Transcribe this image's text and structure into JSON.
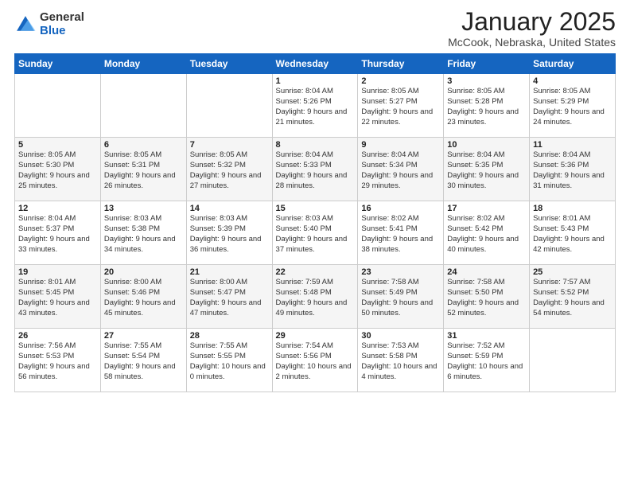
{
  "logo": {
    "general": "General",
    "blue": "Blue"
  },
  "header": {
    "title": "January 2025",
    "subtitle": "McCook, Nebraska, United States"
  },
  "weekdays": [
    "Sunday",
    "Monday",
    "Tuesday",
    "Wednesday",
    "Thursday",
    "Friday",
    "Saturday"
  ],
  "weeks": [
    [
      {
        "day": "",
        "sunrise": "",
        "sunset": "",
        "daylight": ""
      },
      {
        "day": "",
        "sunrise": "",
        "sunset": "",
        "daylight": ""
      },
      {
        "day": "",
        "sunrise": "",
        "sunset": "",
        "daylight": ""
      },
      {
        "day": "1",
        "sunrise": "Sunrise: 8:04 AM",
        "sunset": "Sunset: 5:26 PM",
        "daylight": "Daylight: 9 hours and 21 minutes."
      },
      {
        "day": "2",
        "sunrise": "Sunrise: 8:05 AM",
        "sunset": "Sunset: 5:27 PM",
        "daylight": "Daylight: 9 hours and 22 minutes."
      },
      {
        "day": "3",
        "sunrise": "Sunrise: 8:05 AM",
        "sunset": "Sunset: 5:28 PM",
        "daylight": "Daylight: 9 hours and 23 minutes."
      },
      {
        "day": "4",
        "sunrise": "Sunrise: 8:05 AM",
        "sunset": "Sunset: 5:29 PM",
        "daylight": "Daylight: 9 hours and 24 minutes."
      }
    ],
    [
      {
        "day": "5",
        "sunrise": "Sunrise: 8:05 AM",
        "sunset": "Sunset: 5:30 PM",
        "daylight": "Daylight: 9 hours and 25 minutes."
      },
      {
        "day": "6",
        "sunrise": "Sunrise: 8:05 AM",
        "sunset": "Sunset: 5:31 PM",
        "daylight": "Daylight: 9 hours and 26 minutes."
      },
      {
        "day": "7",
        "sunrise": "Sunrise: 8:05 AM",
        "sunset": "Sunset: 5:32 PM",
        "daylight": "Daylight: 9 hours and 27 minutes."
      },
      {
        "day": "8",
        "sunrise": "Sunrise: 8:04 AM",
        "sunset": "Sunset: 5:33 PM",
        "daylight": "Daylight: 9 hours and 28 minutes."
      },
      {
        "day": "9",
        "sunrise": "Sunrise: 8:04 AM",
        "sunset": "Sunset: 5:34 PM",
        "daylight": "Daylight: 9 hours and 29 minutes."
      },
      {
        "day": "10",
        "sunrise": "Sunrise: 8:04 AM",
        "sunset": "Sunset: 5:35 PM",
        "daylight": "Daylight: 9 hours and 30 minutes."
      },
      {
        "day": "11",
        "sunrise": "Sunrise: 8:04 AM",
        "sunset": "Sunset: 5:36 PM",
        "daylight": "Daylight: 9 hours and 31 minutes."
      }
    ],
    [
      {
        "day": "12",
        "sunrise": "Sunrise: 8:04 AM",
        "sunset": "Sunset: 5:37 PM",
        "daylight": "Daylight: 9 hours and 33 minutes."
      },
      {
        "day": "13",
        "sunrise": "Sunrise: 8:03 AM",
        "sunset": "Sunset: 5:38 PM",
        "daylight": "Daylight: 9 hours and 34 minutes."
      },
      {
        "day": "14",
        "sunrise": "Sunrise: 8:03 AM",
        "sunset": "Sunset: 5:39 PM",
        "daylight": "Daylight: 9 hours and 36 minutes."
      },
      {
        "day": "15",
        "sunrise": "Sunrise: 8:03 AM",
        "sunset": "Sunset: 5:40 PM",
        "daylight": "Daylight: 9 hours and 37 minutes."
      },
      {
        "day": "16",
        "sunrise": "Sunrise: 8:02 AM",
        "sunset": "Sunset: 5:41 PM",
        "daylight": "Daylight: 9 hours and 38 minutes."
      },
      {
        "day": "17",
        "sunrise": "Sunrise: 8:02 AM",
        "sunset": "Sunset: 5:42 PM",
        "daylight": "Daylight: 9 hours and 40 minutes."
      },
      {
        "day": "18",
        "sunrise": "Sunrise: 8:01 AM",
        "sunset": "Sunset: 5:43 PM",
        "daylight": "Daylight: 9 hours and 42 minutes."
      }
    ],
    [
      {
        "day": "19",
        "sunrise": "Sunrise: 8:01 AM",
        "sunset": "Sunset: 5:45 PM",
        "daylight": "Daylight: 9 hours and 43 minutes."
      },
      {
        "day": "20",
        "sunrise": "Sunrise: 8:00 AM",
        "sunset": "Sunset: 5:46 PM",
        "daylight": "Daylight: 9 hours and 45 minutes."
      },
      {
        "day": "21",
        "sunrise": "Sunrise: 8:00 AM",
        "sunset": "Sunset: 5:47 PM",
        "daylight": "Daylight: 9 hours and 47 minutes."
      },
      {
        "day": "22",
        "sunrise": "Sunrise: 7:59 AM",
        "sunset": "Sunset: 5:48 PM",
        "daylight": "Daylight: 9 hours and 49 minutes."
      },
      {
        "day": "23",
        "sunrise": "Sunrise: 7:58 AM",
        "sunset": "Sunset: 5:49 PM",
        "daylight": "Daylight: 9 hours and 50 minutes."
      },
      {
        "day": "24",
        "sunrise": "Sunrise: 7:58 AM",
        "sunset": "Sunset: 5:50 PM",
        "daylight": "Daylight: 9 hours and 52 minutes."
      },
      {
        "day": "25",
        "sunrise": "Sunrise: 7:57 AM",
        "sunset": "Sunset: 5:52 PM",
        "daylight": "Daylight: 9 hours and 54 minutes."
      }
    ],
    [
      {
        "day": "26",
        "sunrise": "Sunrise: 7:56 AM",
        "sunset": "Sunset: 5:53 PM",
        "daylight": "Daylight: 9 hours and 56 minutes."
      },
      {
        "day": "27",
        "sunrise": "Sunrise: 7:55 AM",
        "sunset": "Sunset: 5:54 PM",
        "daylight": "Daylight: 9 hours and 58 minutes."
      },
      {
        "day": "28",
        "sunrise": "Sunrise: 7:55 AM",
        "sunset": "Sunset: 5:55 PM",
        "daylight": "Daylight: 10 hours and 0 minutes."
      },
      {
        "day": "29",
        "sunrise": "Sunrise: 7:54 AM",
        "sunset": "Sunset: 5:56 PM",
        "daylight": "Daylight: 10 hours and 2 minutes."
      },
      {
        "day": "30",
        "sunrise": "Sunrise: 7:53 AM",
        "sunset": "Sunset: 5:58 PM",
        "daylight": "Daylight: 10 hours and 4 minutes."
      },
      {
        "day": "31",
        "sunrise": "Sunrise: 7:52 AM",
        "sunset": "Sunset: 5:59 PM",
        "daylight": "Daylight: 10 hours and 6 minutes."
      },
      {
        "day": "",
        "sunrise": "",
        "sunset": "",
        "daylight": ""
      }
    ]
  ]
}
